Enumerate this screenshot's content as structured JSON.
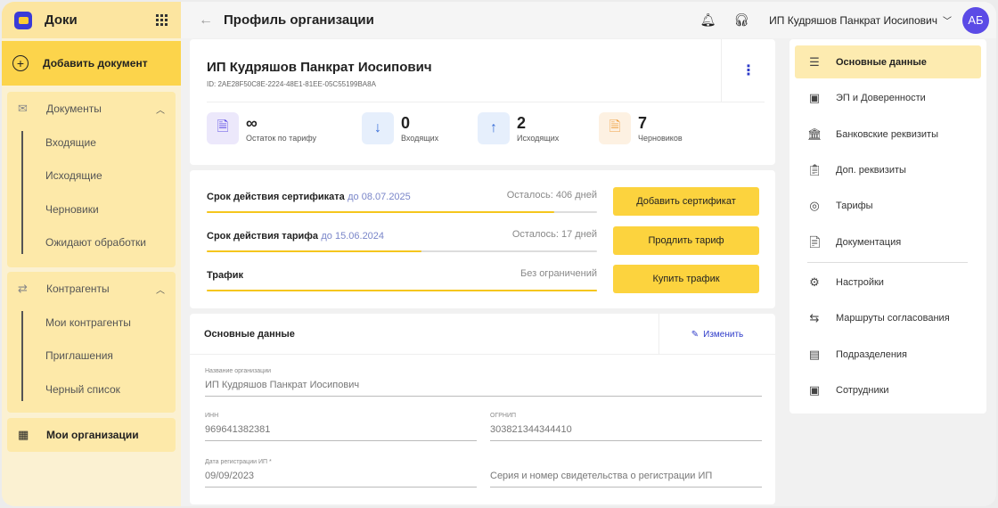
{
  "app": {
    "name": "Доки"
  },
  "sidebar": {
    "add_document": "Добавить документ",
    "documents": {
      "label": "Документы",
      "items": [
        "Входящие",
        "Исходящие",
        "Черновики",
        "Ожидают обработки"
      ]
    },
    "counterparties": {
      "label": "Контрагенты",
      "items": [
        "Мои контрагенты",
        "Приглашения",
        "Черный список"
      ]
    },
    "my_orgs": "Мои организации"
  },
  "topbar": {
    "title": "Профиль организации",
    "user_name": "ИП Кудряшов Панкрат Иосипович",
    "avatar_initials": "АБ"
  },
  "org": {
    "name": "ИП Кудряшов Панкрат Иосипович",
    "id": "ID: 2AE28F50C8E-2224-48E1-81EE-05C55199BA8A",
    "stats": [
      {
        "value": "∞",
        "label": "Остаток по тарифу",
        "icon": "document-icon",
        "color": "#ece8fb"
      },
      {
        "value": "0",
        "label": "Входящих",
        "icon": "arrow-down-icon",
        "color": "#e6effc"
      },
      {
        "value": "2",
        "label": "Исходящих",
        "icon": "arrow-up-icon",
        "color": "#e6effc"
      },
      {
        "value": "7",
        "label": "Черновиков",
        "icon": "draft-icon",
        "color": "#fdf1e2"
      }
    ]
  },
  "limits": [
    {
      "title": "Срок действия сертификата",
      "date": "до 08.07.2025",
      "left": "Осталось: 406 дней",
      "progress": 0.89,
      "button": "Добавить сертификат"
    },
    {
      "title": "Срок действия тарифа",
      "date": "до 15.06.2024",
      "left": "Осталось: 17 дней",
      "progress": 0.55,
      "button": "Продлить тариф"
    },
    {
      "title": "Трафик",
      "date": "",
      "left": "Без ограничений",
      "progress": 1.0,
      "button": "Купить трафик"
    }
  ],
  "main": {
    "title": "Основные данные",
    "edit": "Изменить",
    "fields": {
      "org_name": {
        "label": "Название организации",
        "value": "ИП Кудряшов Панкрат Иосипович"
      },
      "inn": {
        "label": "ИНН",
        "value": "969641382381"
      },
      "ogrnip": {
        "label": "ОГРНИП",
        "value": "303821344344410"
      },
      "reg_date": {
        "label": "Дата регистрации ИП *",
        "value": "09/09/2023"
      },
      "cert": {
        "label": "",
        "value": "Серия и номер свидетельства о регистрации ИП"
      }
    }
  },
  "right_menu": [
    {
      "label": "Основные данные",
      "icon": "list-icon",
      "active": true
    },
    {
      "label": "ЭП и Доверенности",
      "icon": "id-card-icon"
    },
    {
      "label": "Банковские реквизиты",
      "icon": "bank-icon"
    },
    {
      "label": "Доп. реквизиты",
      "icon": "clipboard-icon"
    },
    {
      "label": "Тарифы",
      "icon": "tariff-icon"
    },
    {
      "label": "Документация",
      "icon": "doc-list-icon"
    },
    {
      "label": "Настройки",
      "icon": "gear-icon"
    },
    {
      "label": "Маршруты согласования",
      "icon": "route-icon"
    },
    {
      "label": "Подразделения",
      "icon": "building-icon"
    },
    {
      "label": "Сотрудники",
      "icon": "person-card-icon"
    }
  ]
}
